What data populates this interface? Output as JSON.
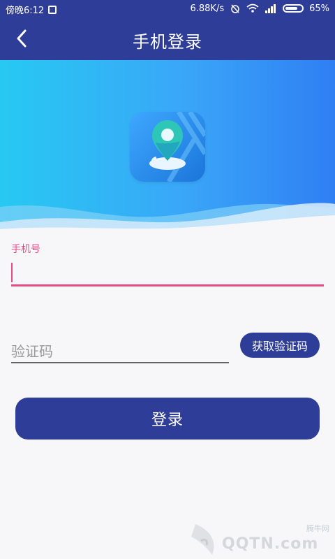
{
  "status_bar": {
    "time": "傍晚6:12",
    "speed": "6.88K/s",
    "battery_text": "65%",
    "battery_level": 0.65
  },
  "header": {
    "title": "手机登录"
  },
  "form": {
    "phone_label": "手机号",
    "phone_value": "",
    "code_placeholder": "验证码",
    "get_code_label": "获取验证码",
    "login_label": "登录"
  },
  "watermark": {
    "brand": "QQTN.com",
    "site": "腾牛网"
  },
  "colors": {
    "primary": "#2e3d98",
    "accent": "#e64b86",
    "hero_start": "#27c9f2",
    "hero_end": "#2f7ff3"
  },
  "icons": {
    "back": "back-chevron-icon",
    "app_logo": "location-pin-icon"
  }
}
